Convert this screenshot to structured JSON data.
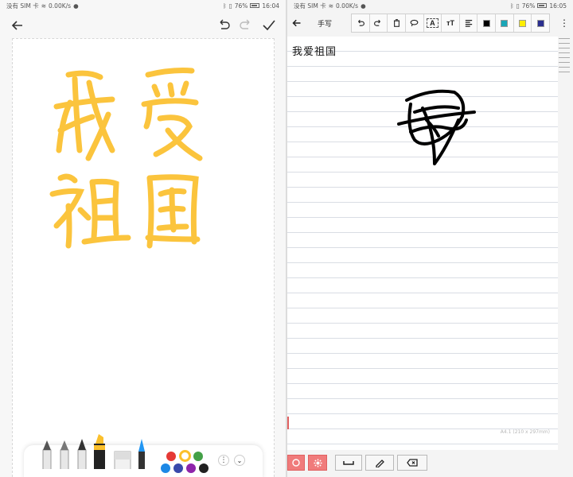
{
  "left": {
    "status": {
      "carrier": "没有 SIM 卡",
      "speed": "0.00K/s",
      "battery": "76%",
      "time": "16:04"
    },
    "handwriting": [
      "我",
      "爱",
      "祖",
      "国"
    ],
    "colors": [
      "#e53935",
      "#fbc02d",
      "#43a047",
      "#1e88e5",
      "#3949ab",
      "#8e24aa",
      "#212121"
    ],
    "selected_color": "#fbc02d",
    "ink_color": "#fbc02d",
    "icons": {
      "back": "back-arrow-icon",
      "undo": "undo-icon",
      "redo": "redo-icon",
      "done": "checkmark-icon",
      "more": "more-icon",
      "collapse": "chevron-down-icon"
    }
  },
  "right": {
    "status": {
      "carrier": "没有 SIM 卡",
      "speed": "0.00K/s",
      "battery": "76%",
      "time": "16:05"
    },
    "title": "手写",
    "recognized_text": "我爱祖国",
    "page_label": "A4.1 (210 x 297mm)",
    "toolbar_colors": [
      "#000000",
      "#1aa6b7",
      "#ffee00",
      "#2b2f8f"
    ],
    "toolbar_text_btn": "A",
    "icons": {
      "back": "back-arrow-icon",
      "undo": "undo-icon",
      "redo": "redo-icon",
      "delete": "trash-icon",
      "lasso": "lasso-icon",
      "text": "text-icon",
      "font_size": "font-size-icon",
      "align": "align-icon",
      "more": "more-vertical-icon"
    },
    "bottom_icons": [
      "circle-icon",
      "settings-icon",
      "space-icon",
      "eraser-pen-icon",
      "backspace-icon"
    ]
  }
}
